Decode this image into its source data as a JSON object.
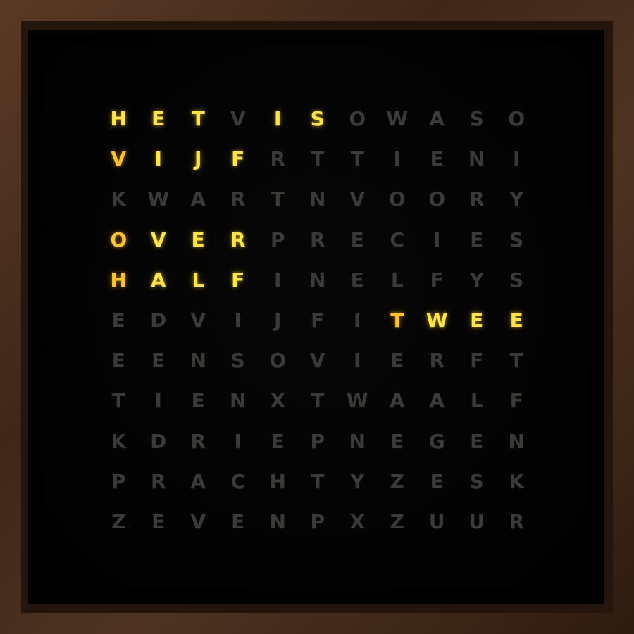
{
  "clock": {
    "grid_rows": [
      "HETVISOWASO",
      "VIJFRTTIENI",
      "KWARTNVOORY",
      "OVERPRECIES",
      "HALFINELFYS",
      "EDVIJFITWEE",
      "EENSOVIERFT",
      "TIENXTWAALF",
      "KDRIEPNEGEN",
      "PRACHTYZESK",
      "ZEVENPXZUUR"
    ],
    "lit_words": [
      {
        "text": "HET",
        "row": 0,
        "start": 0
      },
      {
        "text": "IS",
        "row": 0,
        "start": 4
      },
      {
        "text": "VIJF",
        "row": 1,
        "start": 0
      },
      {
        "text": "OVER",
        "row": 3,
        "start": 0
      },
      {
        "text": "HALF",
        "row": 4,
        "start": 0
      },
      {
        "text": "TWEE",
        "row": 5,
        "start": 7
      }
    ],
    "colors": {
      "lit": "#ffe34d",
      "lit_warm": "#ffc233",
      "unlit": "#3a3a36",
      "face": "#000000",
      "frame": "#4a2f1e"
    }
  }
}
